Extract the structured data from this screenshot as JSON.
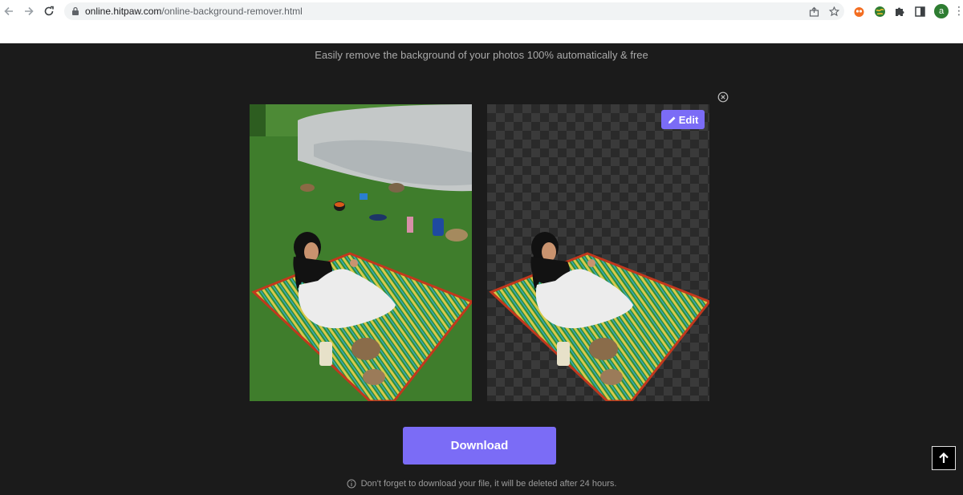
{
  "browser": {
    "url_domain": "online.hitpaw.com",
    "url_path": "/online-background-remover.html",
    "avatar_letter": "a",
    "icons": {
      "back": "arrow-left-icon",
      "forward": "arrow-right-icon",
      "reload": "reload-icon",
      "lock": "lock-icon",
      "share": "share-icon",
      "bookmark": "star-icon",
      "extensions": "puzzle-icon",
      "side_panel": "side-panel-icon",
      "menu": "kebab-menu-icon"
    }
  },
  "page": {
    "tagline": "Easily remove the background of your photos 100% automatically & free",
    "edit_label": "Edit",
    "download_label": "Download",
    "notice": "Don't forget to download your file, it will be deleted after 24 hours.",
    "icons": {
      "close": "close-circle-icon",
      "edit": "pencil-icon",
      "info": "info-icon",
      "back_to_top": "arrow-up-icon"
    }
  },
  "colors": {
    "page_background": "#1b1b1b",
    "accent": "#7b6cf6",
    "tagline_text": "#a9a9a9"
  }
}
